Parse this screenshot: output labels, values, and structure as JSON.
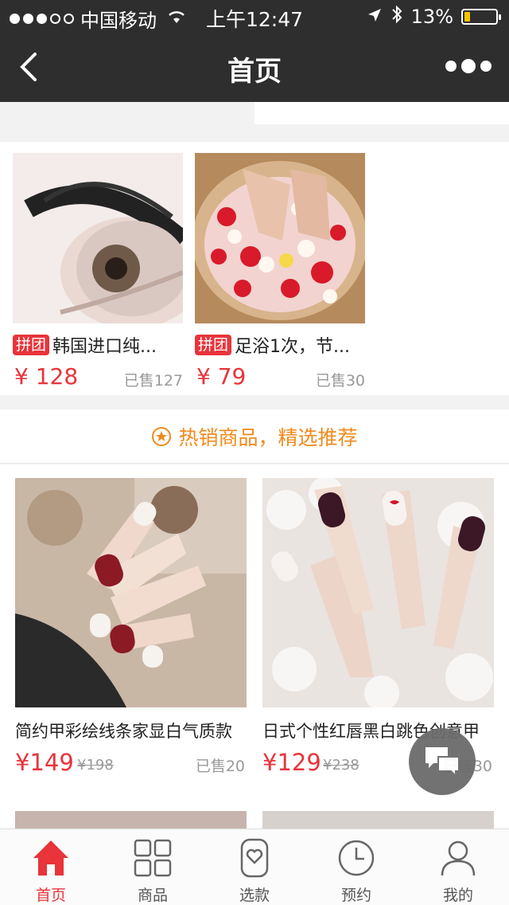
{
  "status_bar": {
    "carrier": "中国移动",
    "time": "上午12:47",
    "battery": "13%",
    "battery_level": 0.13
  },
  "nav": {
    "title": "首页"
  },
  "group_deals": [
    {
      "tag": "拼团",
      "title": "韩国进口纯...",
      "price": "¥ 128",
      "sold": "已售127",
      "icon": "eyelash-photo"
    },
    {
      "tag": "拼团",
      "title": "足浴1次，节...",
      "price": "¥ 79",
      "sold": "已售30",
      "icon": "foot-bath-photo"
    }
  ],
  "hot_section": {
    "title": "热销商品，精选推荐",
    "icon": "star-circle-icon",
    "color": "#f08a1c"
  },
  "products": [
    {
      "title": "简约甲彩绘线条家显白气质款",
      "price": "¥149",
      "original_price": "¥198",
      "sold": "已售20",
      "icon": "nail-art-photo"
    },
    {
      "title": "日式个性红唇黑白跳色创意甲",
      "price": "¥129",
      "original_price": "¥238",
      "sold": "已售30",
      "icon": "nail-art-photo"
    }
  ],
  "tabs": [
    {
      "label": "首页",
      "icon": "home-icon",
      "active": true
    },
    {
      "label": "商品",
      "icon": "grid-icon",
      "active": false
    },
    {
      "label": "选款",
      "icon": "heart-tag-icon",
      "active": false
    },
    {
      "label": "预约",
      "icon": "clock-icon",
      "active": false
    },
    {
      "label": "我的",
      "icon": "user-icon",
      "active": false
    }
  ],
  "colors": {
    "accent": "#e8343a",
    "header_bg": "#2e2e2e",
    "hot": "#f08a1c"
  }
}
